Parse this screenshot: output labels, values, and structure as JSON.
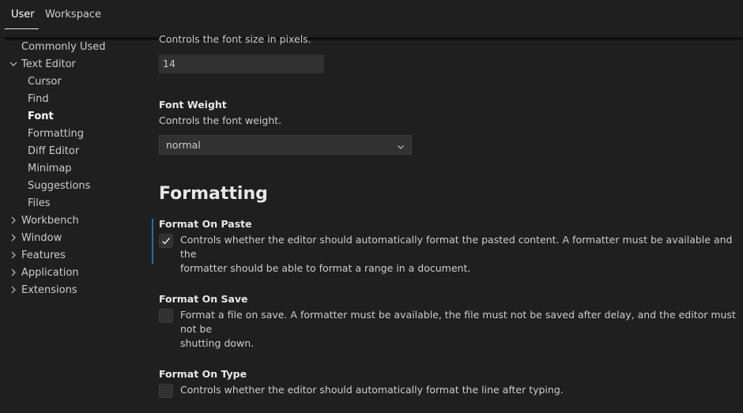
{
  "tabs": {
    "user": "User",
    "workspace": "Workspace"
  },
  "sidebar": {
    "items": [
      {
        "label": "Commonly Used"
      },
      {
        "label": "Text Editor",
        "expanded": true
      },
      {
        "label": "Cursor"
      },
      {
        "label": "Find"
      },
      {
        "label": "Font",
        "active": true
      },
      {
        "label": "Formatting"
      },
      {
        "label": "Diff Editor"
      },
      {
        "label": "Minimap"
      },
      {
        "label": "Suggestions"
      },
      {
        "label": "Files"
      },
      {
        "label": "Workbench",
        "collapsed": true
      },
      {
        "label": "Window",
        "collapsed": true
      },
      {
        "label": "Features",
        "collapsed": true
      },
      {
        "label": "Application",
        "collapsed": true
      },
      {
        "label": "Extensions",
        "collapsed": true
      }
    ]
  },
  "settings": {
    "font_size": {
      "description": "Controls the font size in pixels.",
      "value": "14"
    },
    "font_weight": {
      "title": "Font Weight",
      "description": "Controls the font weight.",
      "value": "normal"
    },
    "formatting_heading": "Formatting",
    "format_on_paste": {
      "title": "Format On Paste",
      "description_line1": "Controls whether the editor should automatically format the pasted content. A formatter must be available and the",
      "description_line2": "formatter should be able to format a range in a document.",
      "checked": true
    },
    "format_on_save": {
      "title": "Format On Save",
      "description_line1": "Format a file on save. A formatter must be available, the file must not be saved after delay, and the editor must not be",
      "description_line2": "shutting down.",
      "checked": false
    },
    "format_on_type": {
      "title": "Format On Type",
      "description": "Controls whether the editor should automatically format the line after typing.",
      "checked": false
    }
  },
  "colors": {
    "background": "#1f1f1f",
    "input_background": "#313131",
    "focus_accent": "#2a6aa6"
  }
}
